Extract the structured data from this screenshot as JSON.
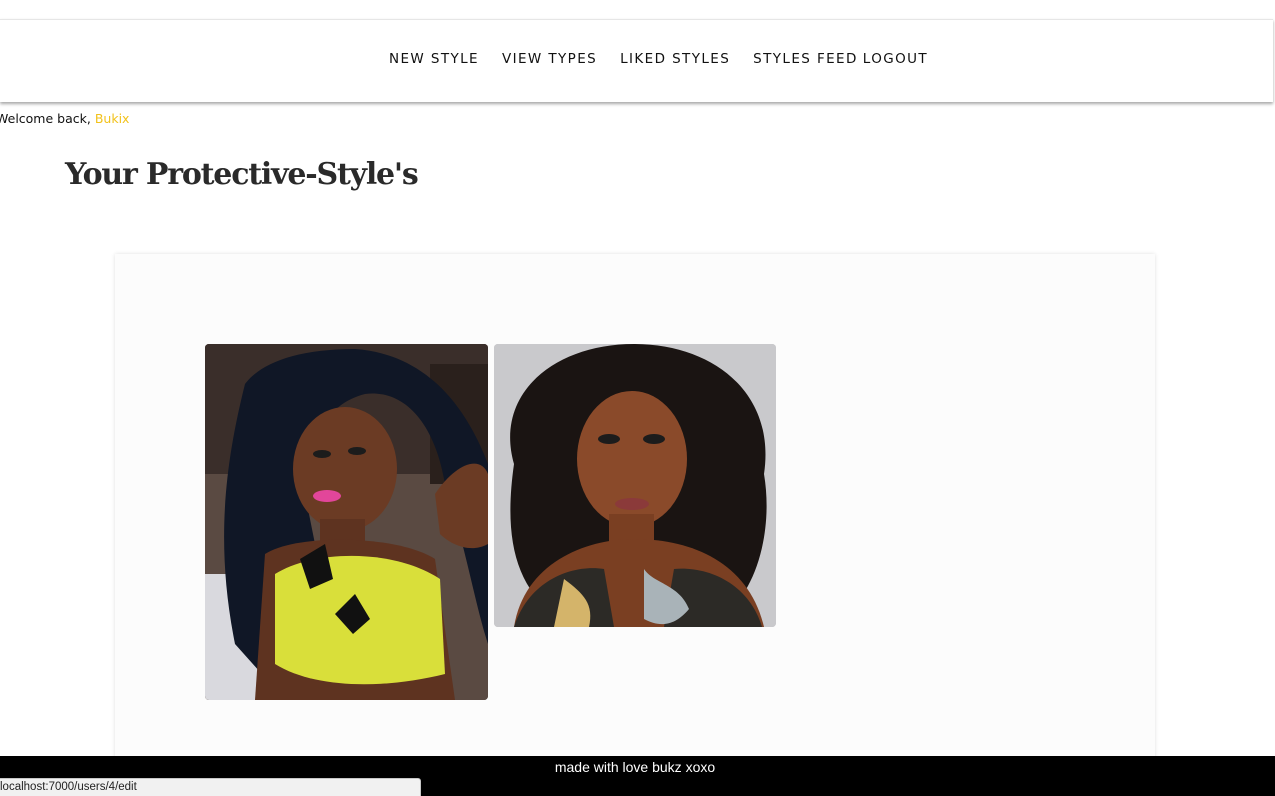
{
  "nav": {
    "links": [
      "NEW STYLE",
      "VIEW TYPES",
      "LIKED STYLES",
      "STYLES FEED",
      "LOGOUT"
    ]
  },
  "welcome": {
    "prefix": "Welcome back,",
    "username": "Bukix"
  },
  "page_title": "Your Protective-Style's",
  "styles": {
    "cards": [
      {
        "icon": "long-wavy-hair-style-photo"
      },
      {
        "icon": "curly-afro-hair-style-photo"
      }
    ]
  },
  "footer": {
    "text": "made with love bukz xoxo"
  },
  "status_bar": {
    "url": "localhost:7000/users/4/edit"
  },
  "colors": {
    "accent_username": "#f2c21b",
    "footer_bg": "#000000",
    "panel_bg": "#fcfcfc"
  }
}
